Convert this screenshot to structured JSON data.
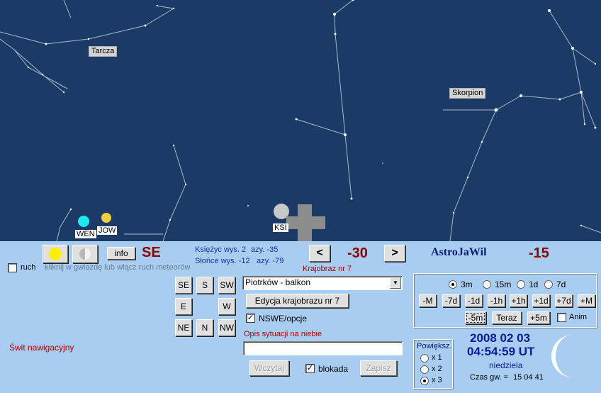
{
  "sky": {
    "constellations": {
      "tarcza": "Tarcza",
      "skorpion": "Skorpion"
    },
    "planets": {
      "wen": "WEN",
      "jow": "JOW",
      "ksi": "KSI"
    },
    "colors": {
      "background": "#1b3a66",
      "venus": "#20e8f0",
      "jupiter": "#f0d040",
      "moon": "#c8c8c8"
    }
  },
  "top_bar": {
    "info_label": "info",
    "direction": "SE",
    "moon_alt": "Księżyc wys. 2",
    "moon_az": "azy. -35",
    "sun_alt": "Słońce wys. -12",
    "sun_az": "azy. -79",
    "prev_label": "<",
    "next_label": ">",
    "azimuth_value": "-30",
    "landscape_label": "Krajobraz nr 7",
    "app_title": "AstroJaWil",
    "right_value": "-15"
  },
  "motion": {
    "ruch_label": "ruch",
    "hint": "kliknij w gwiazdę lub włącz ruch meteorów"
  },
  "compass": {
    "se": "SE",
    "s": "S",
    "sw": "SW",
    "e": "E",
    "w": "W",
    "ne": "NE",
    "n": "N",
    "nw": "NW"
  },
  "landscape": {
    "selected": "Piotrków - balkon",
    "edit_label": "Edycja krajobrazu nr 7",
    "nswe_label": "NSWE/opcje",
    "situation_label": "Opis sytuacji na niebie",
    "situation_value": "",
    "load_label": "Wczytaj",
    "lock_label": "blokada",
    "save_label": "Zapisz"
  },
  "twilight": "Świt nawigacyjny",
  "time_step": {
    "options": [
      "3m",
      "15m",
      "1d",
      "7d"
    ],
    "selected": "3m",
    "row1": [
      "-M",
      "-7d",
      "-1d",
      "-1h",
      "+1h",
      "+1d",
      "+7d",
      "+M"
    ],
    "minus5": "-5m",
    "now": "Teraz",
    "plus5": "+5m",
    "anim": "Anim"
  },
  "zoom": {
    "title": "Powiększ.",
    "options": [
      "x 1",
      "x 2",
      "x 3"
    ],
    "selected": "x 3"
  },
  "datetime": {
    "date": "2008 02 03",
    "time": "04:54:59 UT",
    "weekday": "niedziela",
    "sidereal_label": "Czas gw. =",
    "sidereal_value": "15 04 41"
  }
}
